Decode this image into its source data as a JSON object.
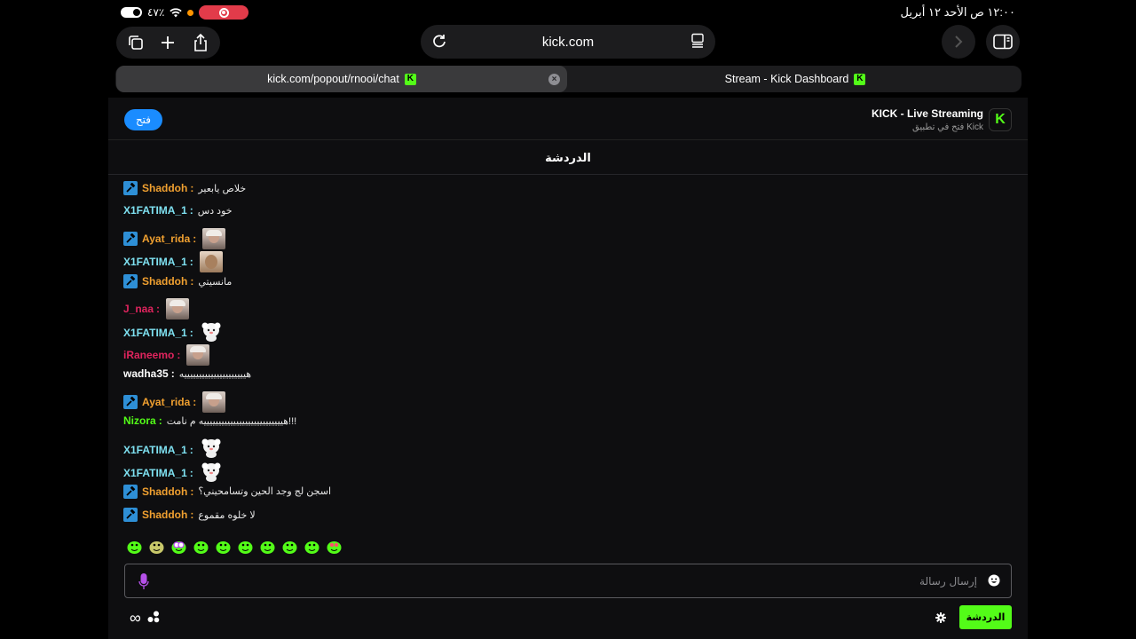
{
  "status_bar": {
    "battery": "٤٧٪",
    "datetime": "١٢:٠٠ ص  الأحد ١٢ أبريل"
  },
  "toolbar": {
    "url": "kick.com"
  },
  "tabs": [
    {
      "label": "kick.com/popout/rnooi/chat",
      "active": true
    },
    {
      "label": "Stream - Kick Dashboard",
      "active": false
    }
  ],
  "banner": {
    "open_label": "فتح",
    "app_title": "KICK - Live Streaming",
    "app_subtitle": "فتح في تطبيق Kick",
    "app_icon_letter": "K"
  },
  "chat": {
    "title": "الدردشة",
    "messages": [
      {
        "user": "Shaddoh",
        "mod": true,
        "color": "#f0a030",
        "text": "خلاص يابعير",
        "emote": null
      },
      {
        "user": "X1FATIMA_1",
        "mod": false,
        "color": "#7ee0f0",
        "text": "خود دس",
        "emote": null
      },
      {
        "user": "Ayat_rida",
        "mod": true,
        "color": "#f0a030",
        "text": "",
        "emote": "photo"
      },
      {
        "user": "X1FATIMA_1",
        "mod": false,
        "color": "#7ee0f0",
        "text": "",
        "emote": "face"
      },
      {
        "user": "Shaddoh",
        "mod": true,
        "color": "#f0a030",
        "text": "مانسيتي",
        "emote": null
      },
      {
        "user": "J_naa",
        "mod": false,
        "color": "#e0245e",
        "text": "",
        "emote": "photo"
      },
      {
        "user": "X1FATIMA_1",
        "mod": false,
        "color": "#7ee0f0",
        "text": "",
        "emote": "mascot"
      },
      {
        "user": "iRaneemo",
        "mod": false,
        "color": "#e0245e",
        "text": "",
        "emote": "photo"
      },
      {
        "user": "wadha35",
        "mod": false,
        "color": "#ffffff",
        "text": "هيييييييييييييييييييييه",
        "emote": null
      },
      {
        "user": "Ayat_rida",
        "mod": true,
        "color": "#f0a030",
        "text": "",
        "emote": "photo"
      },
      {
        "user": "Nizora",
        "mod": false,
        "color": "#53fc18",
        "text": "هيييييييييييييييييييييييييييه م نامت!!!",
        "emote": null
      },
      {
        "user": "X1FATIMA_1",
        "mod": false,
        "color": "#7ee0f0",
        "text": "",
        "emote": "mascot"
      },
      {
        "user": "X1FATIMA_1",
        "mod": false,
        "color": "#7ee0f0",
        "text": "",
        "emote": "mascot"
      },
      {
        "user": "Shaddoh",
        "mod": true,
        "color": "#f0a030",
        "text": "اسجن لج وجد الحين وتسامحيني؟",
        "emote": null
      },
      {
        "user": "Shaddoh",
        "mod": true,
        "color": "#f0a030",
        "text": "لا خلوه مقموع",
        "emote": null
      }
    ],
    "emote_bar": [
      "frog-hat",
      "gift-box",
      "frog-glasses",
      "frog-smile",
      "frog-headphones",
      "frog-grin",
      "frog-happy",
      "frog-wave",
      "frog-flex",
      "frog-love"
    ],
    "input_placeholder": "إرسال رسالة",
    "chat_button": "الدردشة",
    "colors": {
      "kick_green": "#53fc18",
      "mod_blue": "#2e8fd6",
      "open_blue": "#1a8cff"
    }
  }
}
